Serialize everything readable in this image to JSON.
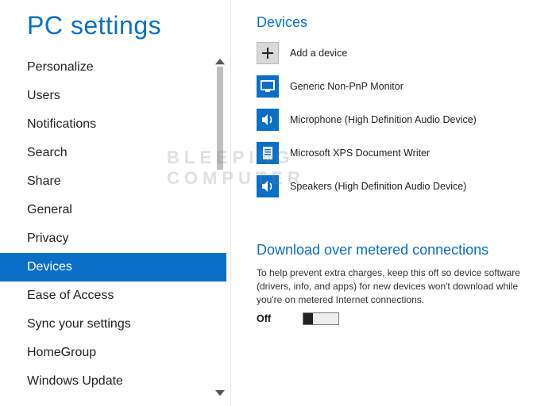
{
  "app_title": "PC settings",
  "sidebar": {
    "items": [
      {
        "label": "Personalize"
      },
      {
        "label": "Users"
      },
      {
        "label": "Notifications"
      },
      {
        "label": "Search"
      },
      {
        "label": "Share"
      },
      {
        "label": "General"
      },
      {
        "label": "Privacy"
      },
      {
        "label": "Devices"
      },
      {
        "label": "Ease of Access"
      },
      {
        "label": "Sync your settings"
      },
      {
        "label": "HomeGroup"
      },
      {
        "label": "Windows Update"
      }
    ],
    "selected_index": 7
  },
  "main": {
    "devices_title": "Devices",
    "devices": [
      {
        "icon": "add-icon",
        "label": "Add a device"
      },
      {
        "icon": "monitor-icon",
        "label": "Generic Non-PnP Monitor"
      },
      {
        "icon": "speaker-icon",
        "label": "Microphone (High Definition Audio Device)"
      },
      {
        "icon": "printer-icon",
        "label": "Microsoft XPS Document Writer"
      },
      {
        "icon": "speaker-icon",
        "label": "Speakers (High Definition Audio Device)"
      }
    ],
    "metered_title": "Download over metered connections",
    "metered_desc": "To help prevent extra charges, keep this off so device software (drivers, info, and apps) for new devices won't download while you're on metered Internet connections.",
    "toggle_label": "Off",
    "toggle_state": "off"
  },
  "watermark": {
    "line1": "BLEEPING",
    "line2": "COMPUTER"
  },
  "colors": {
    "accent": "#0b6fc7"
  }
}
